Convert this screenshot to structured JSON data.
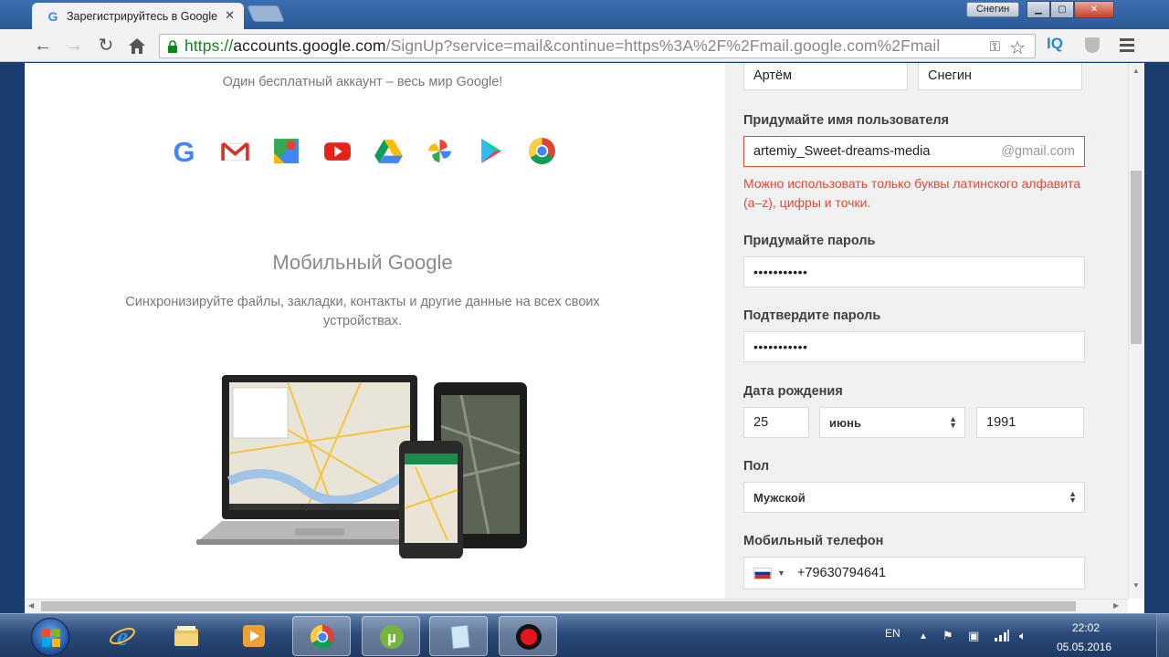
{
  "browser": {
    "tab_title": "Зарегистрируйтесь в Google",
    "tab_close": "✕",
    "profile_name": "Снегин",
    "url_scheme": "https://",
    "url_host": "accounts.google.com",
    "url_path": "/SignUp?service=mail&continue=https%3A%2F%2Fmail.google.com%2Fmail",
    "ext_label": "IQ"
  },
  "left": {
    "tagline": "Один бесплатный аккаунт – весь мир Google!",
    "mobile_title": "Мобильный Google",
    "mobile_desc": "Синхронизируйте файлы, закладки, контакты и другие данные на всех своих устройствах."
  },
  "form": {
    "first_name_value": "Артём",
    "last_name_value": "Снегин",
    "username_label": "Придумайте имя пользователя",
    "username_value": "artemiy_Sweet-dreams-media",
    "username_suffix": "@gmail.com",
    "username_error": "Можно использовать только буквы латинского алфавита (a–z), цифры и точки.",
    "password_label": "Придумайте пароль",
    "password_value": "•••••••••••",
    "confirm_label": "Подтвердите пароль",
    "confirm_value": "•••••••••••",
    "birthdate_label": "Дата рождения",
    "birth_day": "25",
    "birth_month": "июнь",
    "birth_year": "1991",
    "gender_label": "Пол",
    "gender_value": "Мужской",
    "phone_label": "Мобильный телефон",
    "phone_value": "+79630794641"
  },
  "taskbar": {
    "language": "EN",
    "time": "22:02",
    "date": "05.05.2016"
  },
  "colors": {
    "error": "#dd4b39",
    "secure_green": "#0a8a16",
    "accent_blue": "#1e88d8"
  }
}
